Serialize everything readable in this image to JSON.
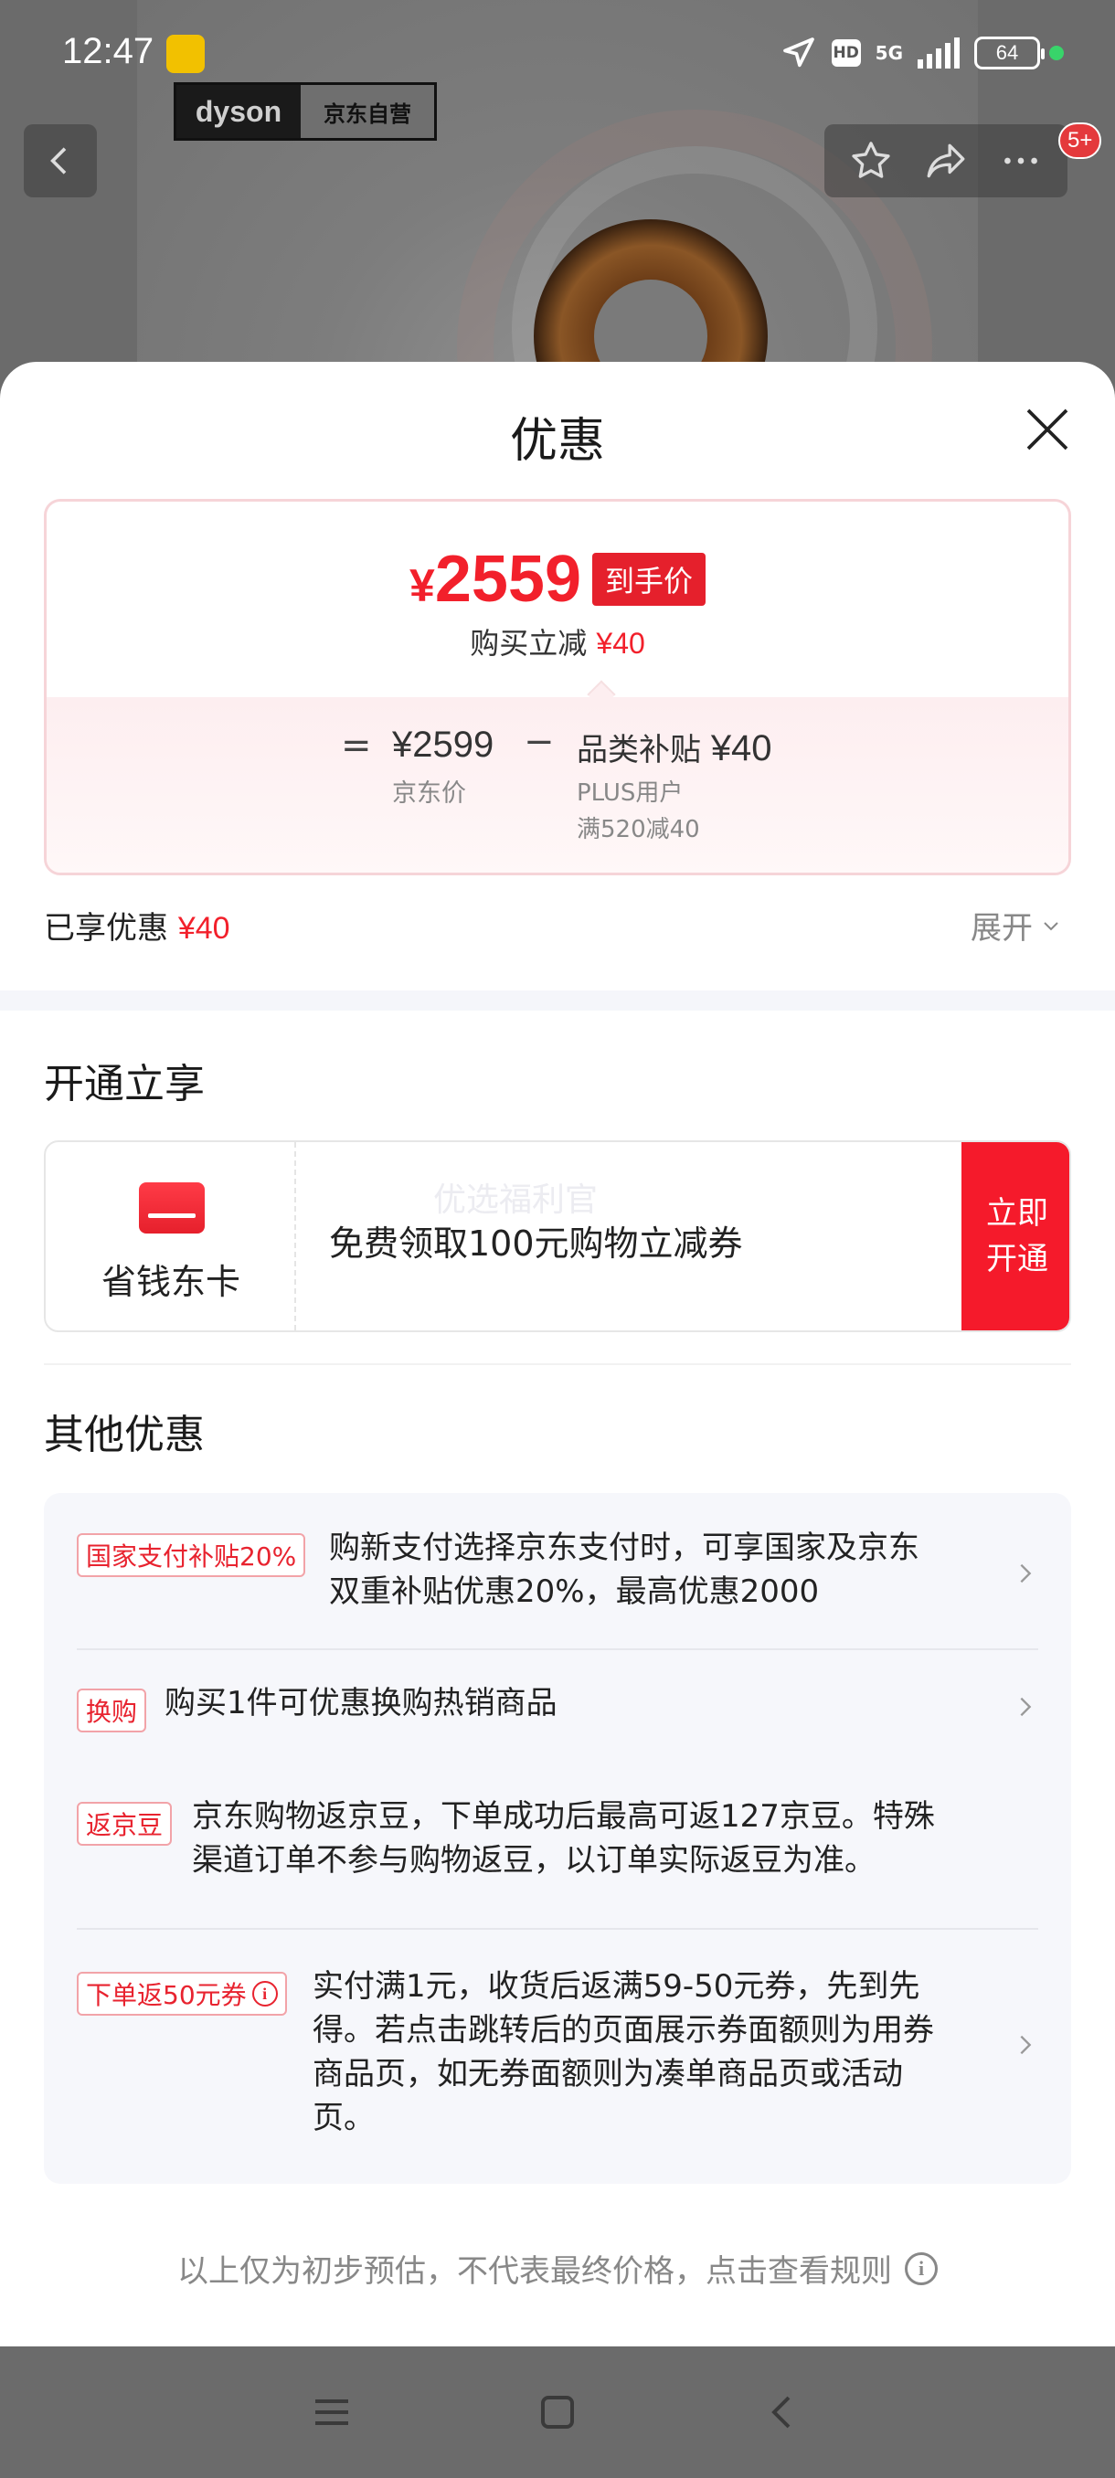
{
  "status_bar": {
    "time": "12:47",
    "network": "5G",
    "hd": "HD",
    "battery": "64"
  },
  "product_header": {
    "brand_logo": "dyson",
    "store_label": "京东自营",
    "cart_badge": "5+"
  },
  "sheet": {
    "title": "优惠",
    "price_card": {
      "final_price_symbol": "¥",
      "final_price": "2559",
      "final_tag": "到手价",
      "instant_discount_label": "购买立减",
      "instant_discount_value": "¥40",
      "equals": "=",
      "base_price": "¥2599",
      "base_price_label": "京东价",
      "minus": "−",
      "subsidy_label": "品类补贴",
      "subsidy_value": "¥40",
      "subsidy_user": "PLUS用户",
      "subsidy_rule": "满520减40"
    },
    "enjoyed": {
      "label": "已享优惠",
      "value": "¥40"
    },
    "expand_label": "展开",
    "membership": {
      "section_title": "开通立享",
      "card_name": "省钱东卡",
      "watermark": "优选福利官",
      "description": "免费领取100元购物立减券",
      "button_label": "立即开通"
    },
    "other_offers": {
      "section_title": "其他优惠",
      "items": [
        {
          "tag": "国家支付补贴20%",
          "text_line1": "购新支付选择京东支付时，可享国家及京东",
          "text_line2": "双重补贴优惠20%，最高优惠2000"
        },
        {
          "tag": "换购",
          "text_line1": "购买1件可优惠换购热销商品"
        },
        {
          "tag": "返京豆",
          "text_line1": "京东购物返京豆，下单成功后最高可返127京豆。特殊",
          "text_line2": "渠道订单不参与购物返豆，以订单实际返豆为准。"
        },
        {
          "tag": "下单返50元券",
          "text_line1": "实付满1元，收货后返满59-50元券，先到先",
          "text_line2": "得。若点击跳转后的页面展示券面额则为用券",
          "text_line3": "商品页，如无券面额则为凑单商品页或活动",
          "text_line4": "页。"
        }
      ]
    },
    "disclaimer": "以上仅为初步预估，不代表最终价格，点击查看规则"
  },
  "colors": {
    "accent_red": "#f2202b",
    "tag_border": "#f2a3a8",
    "offers_bg": "#f6f7fb"
  }
}
